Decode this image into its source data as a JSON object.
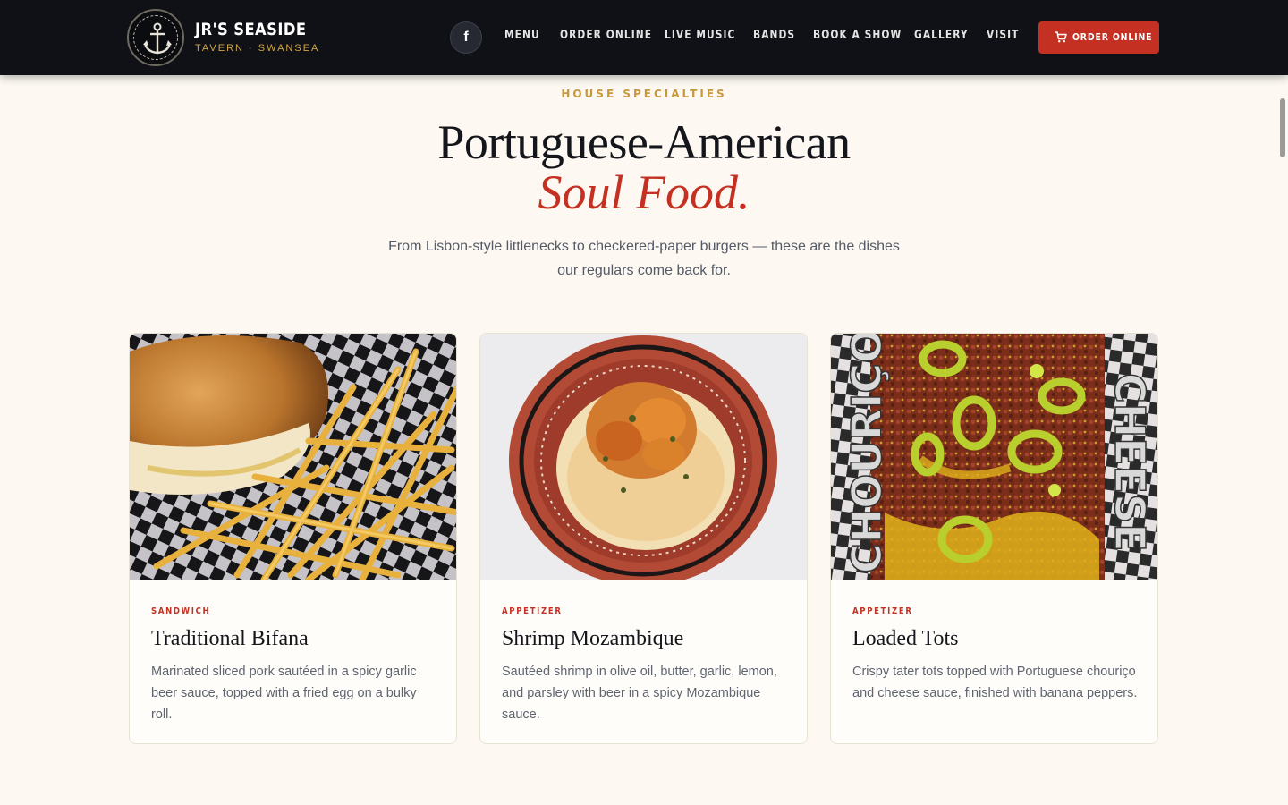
{
  "header": {
    "brand_name": "JR'S SEASIDE",
    "brand_sub": "TAVERN · SWANSEA",
    "facebook_glyph": "f",
    "nav": [
      {
        "label": "MENU"
      },
      {
        "label": "ORDER ONLINE"
      },
      {
        "label": "LIVE MUSIC"
      },
      {
        "label": "BANDS"
      },
      {
        "label": "BOOK A SHOW"
      },
      {
        "label": "GALLERY"
      },
      {
        "label": "VISIT"
      }
    ],
    "cta_label": "ORDER ONLINE",
    "cta_icon": "cart-icon"
  },
  "hero": {
    "eyebrow": "HOUSE SPECIALTIES",
    "title_line1": "Portuguese-American",
    "title_line2": "Soul Food.",
    "lead": "From Lisbon-style littlenecks to checkered-paper burgers — these are the dishes our regulars come back for."
  },
  "cards": [
    {
      "category": "SANDWICH",
      "name": "Traditional Bifana",
      "desc": "Marinated sliced pork sautéed in a spicy garlic beer sauce, topped with a fried egg on a bulky roll."
    },
    {
      "category": "APPETIZER",
      "name": "Shrimp Mozambique",
      "desc": "Sautéed shrimp in olive oil, butter, garlic, lemon, and parsley with beer in a spicy Mozambique sauce."
    },
    {
      "category": "APPETIZER",
      "name": "Loaded Tots",
      "desc": "Crispy tater tots topped with Portuguese chouriço and cheese sauce, finished with banana peppers.",
      "photo_text_left": "CHOURIÇO",
      "photo_text_right": "CHEESE"
    }
  ],
  "colors": {
    "header_bg": "#0f1116",
    "accent_red": "#c43123",
    "gold": "#c8973e",
    "page_bg": "#fdf9f2"
  }
}
